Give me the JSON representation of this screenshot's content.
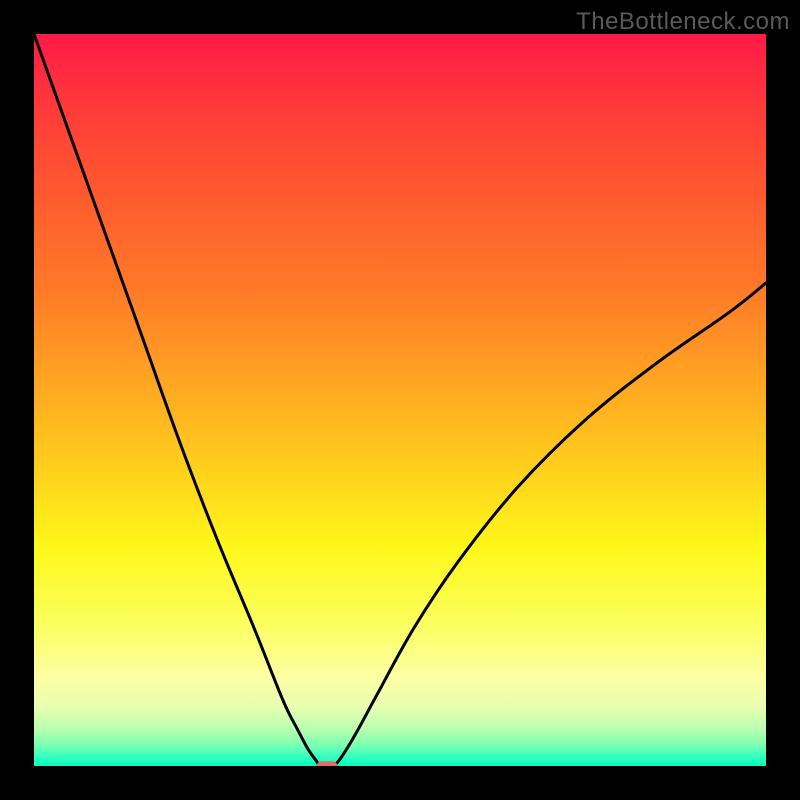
{
  "watermark": "TheBottleneck.com",
  "colors": {
    "background": "#000000",
    "curve": "#000000",
    "marker": "#e06b6b"
  },
  "chart_data": {
    "type": "line",
    "title": "",
    "xlabel": "",
    "ylabel": "",
    "xlim": [
      0,
      100
    ],
    "ylim": [
      0,
      100
    ],
    "grid": false,
    "series": [
      {
        "name": "left-branch",
        "x": [
          0,
          5,
          10,
          15,
          20,
          25,
          30,
          34,
          36,
          37.5,
          38.5,
          39
        ],
        "y": [
          100,
          86,
          72,
          58,
          44,
          31,
          19,
          9,
          5,
          2.2,
          0.8,
          0
        ]
      },
      {
        "name": "right-branch",
        "x": [
          41,
          42,
          44,
          47,
          52,
          58,
          66,
          75,
          85,
          95,
          100
        ],
        "y": [
          0,
          1.2,
          4.5,
          10,
          19,
          28,
          38,
          47,
          55,
          62,
          66
        ]
      }
    ],
    "annotations": [
      {
        "name": "minimum-marker",
        "x": 40,
        "y": 0
      }
    ]
  }
}
